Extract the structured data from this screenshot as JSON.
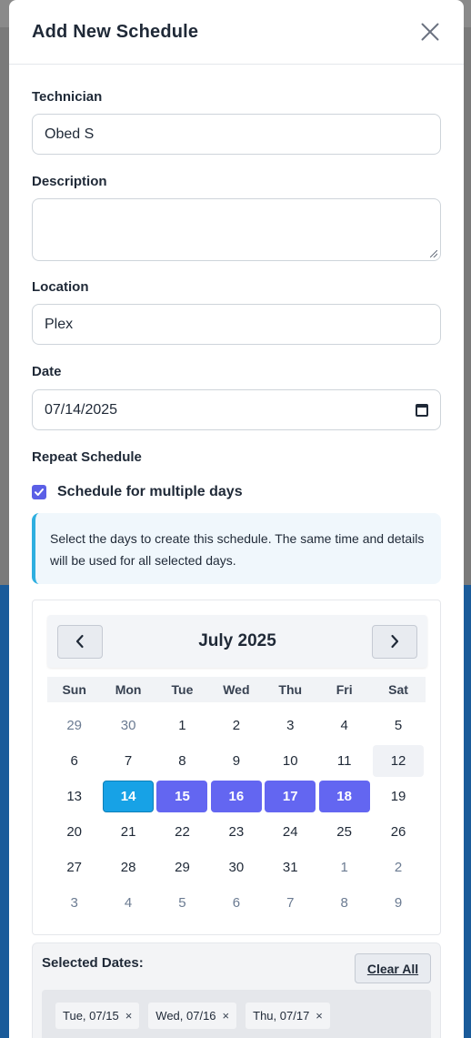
{
  "modal": {
    "title": "Add New Schedule"
  },
  "form": {
    "technician_label": "Technician",
    "technician_value": "Obed S",
    "description_label": "Description",
    "description_value": "",
    "location_label": "Location",
    "location_value": "Plex",
    "date_label": "Date",
    "date_value": "07/14/2025",
    "repeat_label": "Repeat Schedule",
    "multi_day_label": "Schedule for multiple days",
    "multi_day_checked": true,
    "info_text": "Select the days to create this schedule. The same time and details will be used for all selected days."
  },
  "calendar": {
    "month_label": "July 2025",
    "weekdays": [
      "Sun",
      "Mon",
      "Tue",
      "Wed",
      "Thu",
      "Fri",
      "Sat"
    ],
    "days": [
      {
        "label": "29",
        "muted": true
      },
      {
        "label": "30",
        "muted": true
      },
      {
        "label": "1"
      },
      {
        "label": "2"
      },
      {
        "label": "3"
      },
      {
        "label": "4"
      },
      {
        "label": "5"
      },
      {
        "label": "6"
      },
      {
        "label": "7"
      },
      {
        "label": "8"
      },
      {
        "label": "9"
      },
      {
        "label": "10"
      },
      {
        "label": "11"
      },
      {
        "label": "12",
        "today": true
      },
      {
        "label": "13"
      },
      {
        "label": "14",
        "primary": true
      },
      {
        "label": "15",
        "selected": true
      },
      {
        "label": "16",
        "selected": true
      },
      {
        "label": "17",
        "selected": true
      },
      {
        "label": "18",
        "selected": true
      },
      {
        "label": "19"
      },
      {
        "label": "20"
      },
      {
        "label": "21"
      },
      {
        "label": "22"
      },
      {
        "label": "23"
      },
      {
        "label": "24"
      },
      {
        "label": "25"
      },
      {
        "label": "26"
      },
      {
        "label": "27"
      },
      {
        "label": "28"
      },
      {
        "label": "29"
      },
      {
        "label": "30"
      },
      {
        "label": "31"
      },
      {
        "label": "1",
        "muted": true
      },
      {
        "label": "2",
        "muted": true
      },
      {
        "label": "3",
        "muted": true
      },
      {
        "label": "4",
        "muted": true
      },
      {
        "label": "5",
        "muted": true
      },
      {
        "label": "6",
        "muted": true
      },
      {
        "label": "7",
        "muted": true
      },
      {
        "label": "8",
        "muted": true
      },
      {
        "label": "9",
        "muted": true
      }
    ]
  },
  "selected_dates": {
    "title": "Selected Dates:",
    "clear_label": "Clear All",
    "chips": [
      "Tue, 07/15",
      "Wed, 07/16",
      "Thu, 07/17"
    ],
    "remove_glyph": "×"
  },
  "colors": {
    "accent": "#6366f1",
    "primary_day": "#17a2e6",
    "info_border": "#2eafe0"
  }
}
